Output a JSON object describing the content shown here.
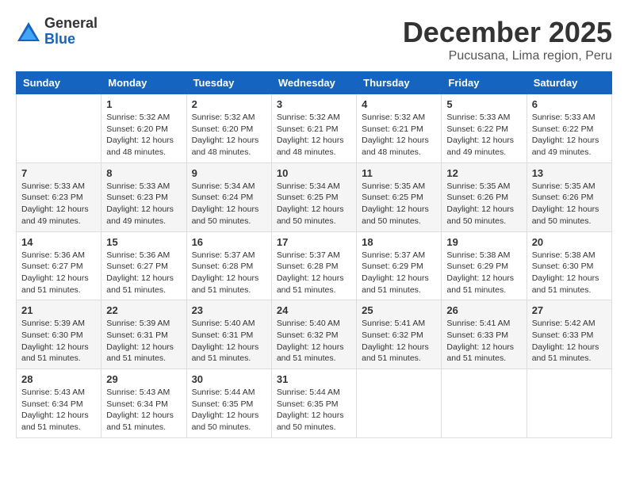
{
  "logo": {
    "general": "General",
    "blue": "Blue"
  },
  "title": "December 2025",
  "location": "Pucusana, Lima region, Peru",
  "days_of_week": [
    "Sunday",
    "Monday",
    "Tuesday",
    "Wednesday",
    "Thursday",
    "Friday",
    "Saturday"
  ],
  "weeks": [
    [
      {
        "day": "",
        "info": ""
      },
      {
        "day": "1",
        "info": "Sunrise: 5:32 AM\nSunset: 6:20 PM\nDaylight: 12 hours\nand 48 minutes."
      },
      {
        "day": "2",
        "info": "Sunrise: 5:32 AM\nSunset: 6:20 PM\nDaylight: 12 hours\nand 48 minutes."
      },
      {
        "day": "3",
        "info": "Sunrise: 5:32 AM\nSunset: 6:21 PM\nDaylight: 12 hours\nand 48 minutes."
      },
      {
        "day": "4",
        "info": "Sunrise: 5:32 AM\nSunset: 6:21 PM\nDaylight: 12 hours\nand 48 minutes."
      },
      {
        "day": "5",
        "info": "Sunrise: 5:33 AM\nSunset: 6:22 PM\nDaylight: 12 hours\nand 49 minutes."
      },
      {
        "day": "6",
        "info": "Sunrise: 5:33 AM\nSunset: 6:22 PM\nDaylight: 12 hours\nand 49 minutes."
      }
    ],
    [
      {
        "day": "7",
        "info": "Sunrise: 5:33 AM\nSunset: 6:23 PM\nDaylight: 12 hours\nand 49 minutes."
      },
      {
        "day": "8",
        "info": "Sunrise: 5:33 AM\nSunset: 6:23 PM\nDaylight: 12 hours\nand 49 minutes."
      },
      {
        "day": "9",
        "info": "Sunrise: 5:34 AM\nSunset: 6:24 PM\nDaylight: 12 hours\nand 50 minutes."
      },
      {
        "day": "10",
        "info": "Sunrise: 5:34 AM\nSunset: 6:25 PM\nDaylight: 12 hours\nand 50 minutes."
      },
      {
        "day": "11",
        "info": "Sunrise: 5:35 AM\nSunset: 6:25 PM\nDaylight: 12 hours\nand 50 minutes."
      },
      {
        "day": "12",
        "info": "Sunrise: 5:35 AM\nSunset: 6:26 PM\nDaylight: 12 hours\nand 50 minutes."
      },
      {
        "day": "13",
        "info": "Sunrise: 5:35 AM\nSunset: 6:26 PM\nDaylight: 12 hours\nand 50 minutes."
      }
    ],
    [
      {
        "day": "14",
        "info": "Sunrise: 5:36 AM\nSunset: 6:27 PM\nDaylight: 12 hours\nand 51 minutes."
      },
      {
        "day": "15",
        "info": "Sunrise: 5:36 AM\nSunset: 6:27 PM\nDaylight: 12 hours\nand 51 minutes."
      },
      {
        "day": "16",
        "info": "Sunrise: 5:37 AM\nSunset: 6:28 PM\nDaylight: 12 hours\nand 51 minutes."
      },
      {
        "day": "17",
        "info": "Sunrise: 5:37 AM\nSunset: 6:28 PM\nDaylight: 12 hours\nand 51 minutes."
      },
      {
        "day": "18",
        "info": "Sunrise: 5:37 AM\nSunset: 6:29 PM\nDaylight: 12 hours\nand 51 minutes."
      },
      {
        "day": "19",
        "info": "Sunrise: 5:38 AM\nSunset: 6:29 PM\nDaylight: 12 hours\nand 51 minutes."
      },
      {
        "day": "20",
        "info": "Sunrise: 5:38 AM\nSunset: 6:30 PM\nDaylight: 12 hours\nand 51 minutes."
      }
    ],
    [
      {
        "day": "21",
        "info": "Sunrise: 5:39 AM\nSunset: 6:30 PM\nDaylight: 12 hours\nand 51 minutes."
      },
      {
        "day": "22",
        "info": "Sunrise: 5:39 AM\nSunset: 6:31 PM\nDaylight: 12 hours\nand 51 minutes."
      },
      {
        "day": "23",
        "info": "Sunrise: 5:40 AM\nSunset: 6:31 PM\nDaylight: 12 hours\nand 51 minutes."
      },
      {
        "day": "24",
        "info": "Sunrise: 5:40 AM\nSunset: 6:32 PM\nDaylight: 12 hours\nand 51 minutes."
      },
      {
        "day": "25",
        "info": "Sunrise: 5:41 AM\nSunset: 6:32 PM\nDaylight: 12 hours\nand 51 minutes."
      },
      {
        "day": "26",
        "info": "Sunrise: 5:41 AM\nSunset: 6:33 PM\nDaylight: 12 hours\nand 51 minutes."
      },
      {
        "day": "27",
        "info": "Sunrise: 5:42 AM\nSunset: 6:33 PM\nDaylight: 12 hours\nand 51 minutes."
      }
    ],
    [
      {
        "day": "28",
        "info": "Sunrise: 5:43 AM\nSunset: 6:34 PM\nDaylight: 12 hours\nand 51 minutes."
      },
      {
        "day": "29",
        "info": "Sunrise: 5:43 AM\nSunset: 6:34 PM\nDaylight: 12 hours\nand 51 minutes."
      },
      {
        "day": "30",
        "info": "Sunrise: 5:44 AM\nSunset: 6:35 PM\nDaylight: 12 hours\nand 50 minutes."
      },
      {
        "day": "31",
        "info": "Sunrise: 5:44 AM\nSunset: 6:35 PM\nDaylight: 12 hours\nand 50 minutes."
      },
      {
        "day": "",
        "info": ""
      },
      {
        "day": "",
        "info": ""
      },
      {
        "day": "",
        "info": ""
      }
    ]
  ]
}
